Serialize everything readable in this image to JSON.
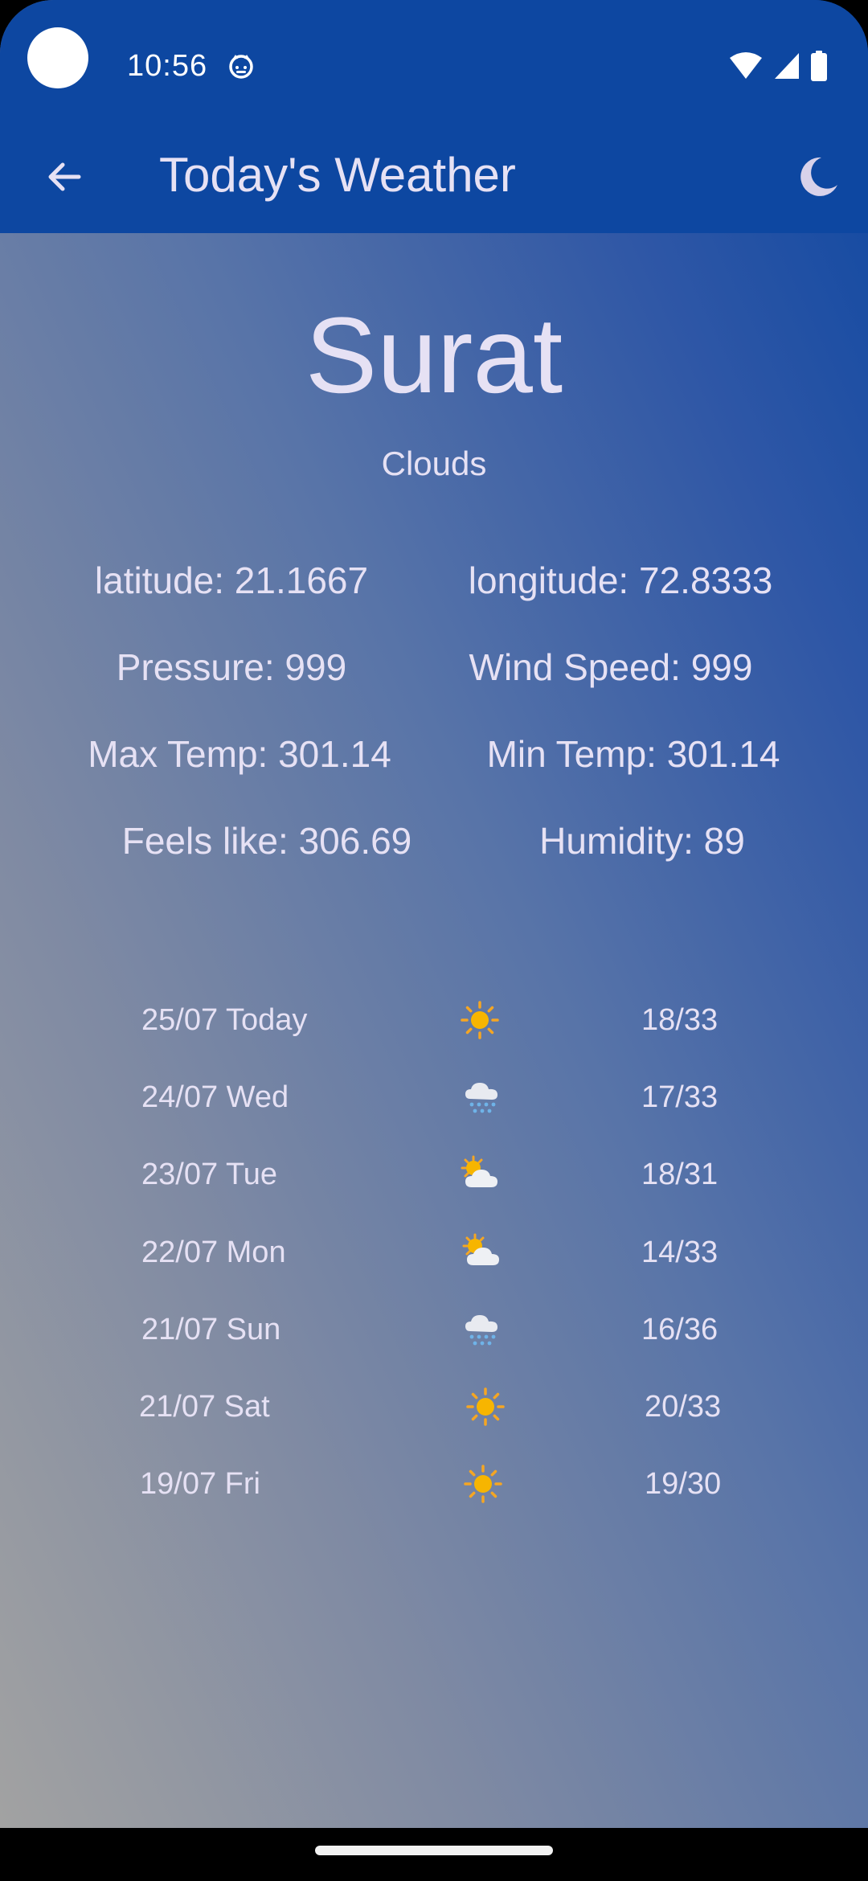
{
  "status_bar": {
    "time": "10:56",
    "icons": [
      "camera-cutout",
      "app-notification-icon",
      "wifi-icon",
      "cellular-signal-icon",
      "battery-icon"
    ]
  },
  "app_bar": {
    "back_icon": "arrow-left-icon",
    "title": "Today's Weather",
    "theme_icon": "crescent-moon-icon"
  },
  "weather": {
    "city": "Surat",
    "condition": "Clouds",
    "stats": {
      "latitude": "latitude: 21.1667",
      "longitude": "longitude: 72.8333",
      "pressure": "Pressure: 999",
      "wind_speed": "Wind Speed: 999",
      "max_temp": "Max Temp: 301.14",
      "min_temp": "Min Temp: 301.14",
      "feels_like": "Feels like: 306.69",
      "humidity": "Humidity: 89"
    }
  },
  "forecast": [
    {
      "date": "25/07 Today",
      "icon": "sun-icon",
      "temp": "18/33"
    },
    {
      "date": "24/07 Wed",
      "icon": "snow-cloud-icon",
      "temp": "17/33"
    },
    {
      "date": "23/07 Tue",
      "icon": "sun-behind-cloud-icon",
      "temp": "18/31"
    },
    {
      "date": "22/07 Mon",
      "icon": "sun-behind-cloud-icon",
      "temp": "14/33"
    },
    {
      "date": "21/07 Sun",
      "icon": "snow-cloud-icon",
      "temp": "16/36"
    },
    {
      "date": "21/07 Sat",
      "icon": "sun-icon",
      "temp": "20/33"
    },
    {
      "date": "19/07 Fri",
      "icon": "sun-icon",
      "temp": "19/30"
    }
  ],
  "colors": {
    "app_bar": "#0d47a1",
    "text": "#e6e1f4",
    "gradient_top_right": "#0d47a1",
    "gradient_bottom_left": "#a2a2a2"
  }
}
